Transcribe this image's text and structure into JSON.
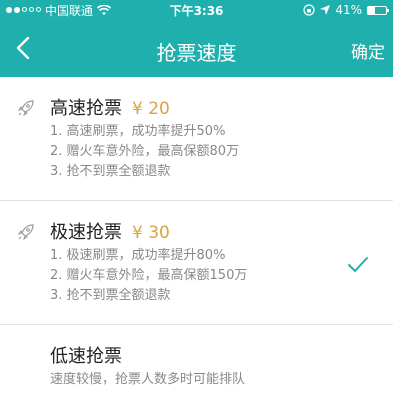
{
  "status": {
    "carrier": "中国联通",
    "time": "下午3:36",
    "battery": "41%",
    "battery_level": 0.41
  },
  "nav": {
    "title": "抢票速度",
    "confirm": "确定"
  },
  "options": [
    {
      "title": "高速抢票",
      "price": "¥ 20",
      "lines": [
        "1. 高速刷票，成功率提升50%",
        "2. 赠火车意外险，最高保额80万",
        "3. 抢不到票全额退款"
      ],
      "selected": false
    },
    {
      "title": "极速抢票",
      "price": "¥ 30",
      "lines": [
        "1. 极速刷票，成功率提升80%",
        "2. 赠火车意外险，最高保额150万",
        "3. 抢不到票全额退款"
      ],
      "selected": true
    },
    {
      "title": "低速抢票",
      "price": "",
      "lines": [
        "速度较慢，抢票人数多时可能排队"
      ],
      "selected": false
    }
  ],
  "colors": {
    "header": "#1fb0ae",
    "price": "#d9a441",
    "check": "#1fb0ae"
  },
  "icons": [
    "signal-dots-icon",
    "wifi-icon",
    "lock-rotation-icon",
    "location-arrow-icon",
    "battery-icon",
    "back-chevron-icon",
    "rocket-icon",
    "checkmark-icon"
  ]
}
